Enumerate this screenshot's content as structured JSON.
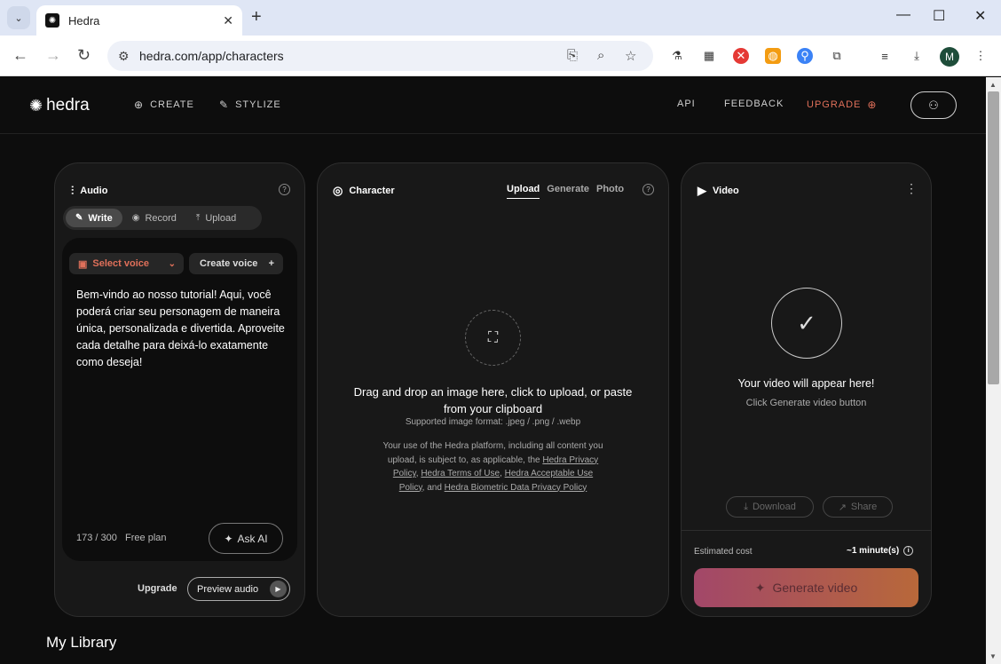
{
  "browser": {
    "tab_title": "Hedra",
    "url": "hedra.com/app/characters",
    "profile_initial": "M"
  },
  "nav": {
    "logo": "hedra",
    "create": "CREATE",
    "stylize": "STYLIZE",
    "api": "API",
    "feedback": "FEEDBACK",
    "upgrade": "UPGRADE"
  },
  "audio": {
    "title": "Audio",
    "modes": [
      "Write",
      "Record",
      "Upload"
    ],
    "select_voice": "Select voice",
    "create_voice": "Create voice",
    "script": "Bem-vindo ao nosso tutorial! Aqui, você poderá criar seu personagem de maneira única, personalizada e divertida. Aproveite cada detalhe para deixá-lo exatamente como deseja!",
    "counter": "173 / 300",
    "plan": "Free plan",
    "ask_ai": "Ask AI",
    "upgrade": "Upgrade",
    "preview": "Preview audio"
  },
  "character": {
    "title": "Character",
    "tabs": [
      "Upload",
      "Generate",
      "Photo"
    ],
    "drag_text": "Drag and drop an image here, click to upload, or paste from your clipboard",
    "formats": "Supported image format: .jpeg / .png / .webp",
    "legal_intro": "Your use of the Hedra platform, including all content you upload, is subject to, as applicable, the",
    "legal_link1": "Hedra Privacy Policy",
    "legal_link2": "Hedra Terms of Use",
    "legal_link3": "Hedra Acceptable Use Policy",
    "legal_and": "and",
    "legal_link4": "Hedra Biometric Data Privacy Policy"
  },
  "video": {
    "title": "Video",
    "placeholder_title": "Your video will appear here!",
    "placeholder_sub": "Click Generate video button",
    "download": "Download",
    "share": "Share",
    "est_label": "Estimated cost",
    "est_value": "~1 minute(s)",
    "generate": "Generate video"
  },
  "library": {
    "title": "My Library"
  }
}
